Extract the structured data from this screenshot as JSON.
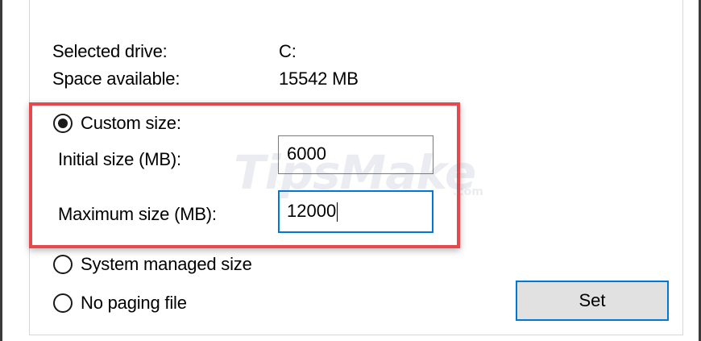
{
  "drive_info": {
    "selected_drive_label": "Selected drive:",
    "selected_drive_value": "C:",
    "space_available_label": "Space available:",
    "space_available_value": "15542 MB"
  },
  "paging_options": {
    "custom_size": {
      "label": "Custom size:",
      "selected": true
    },
    "initial_size": {
      "label": "Initial size (MB):",
      "value": "6000"
    },
    "maximum_size": {
      "label": "Maximum size (MB):",
      "value": "12000"
    },
    "system_managed": {
      "label": "System managed size",
      "selected": false
    },
    "no_paging_file": {
      "label": "No paging file",
      "selected": false
    }
  },
  "buttons": {
    "set_label": "Set"
  },
  "watermark": {
    "brand": "TipsMake",
    "suffix": ".com"
  },
  "colors": {
    "highlight_border": "#e5484d",
    "focus_blue": "#0078d7",
    "button_face": "#e1e1e1"
  }
}
